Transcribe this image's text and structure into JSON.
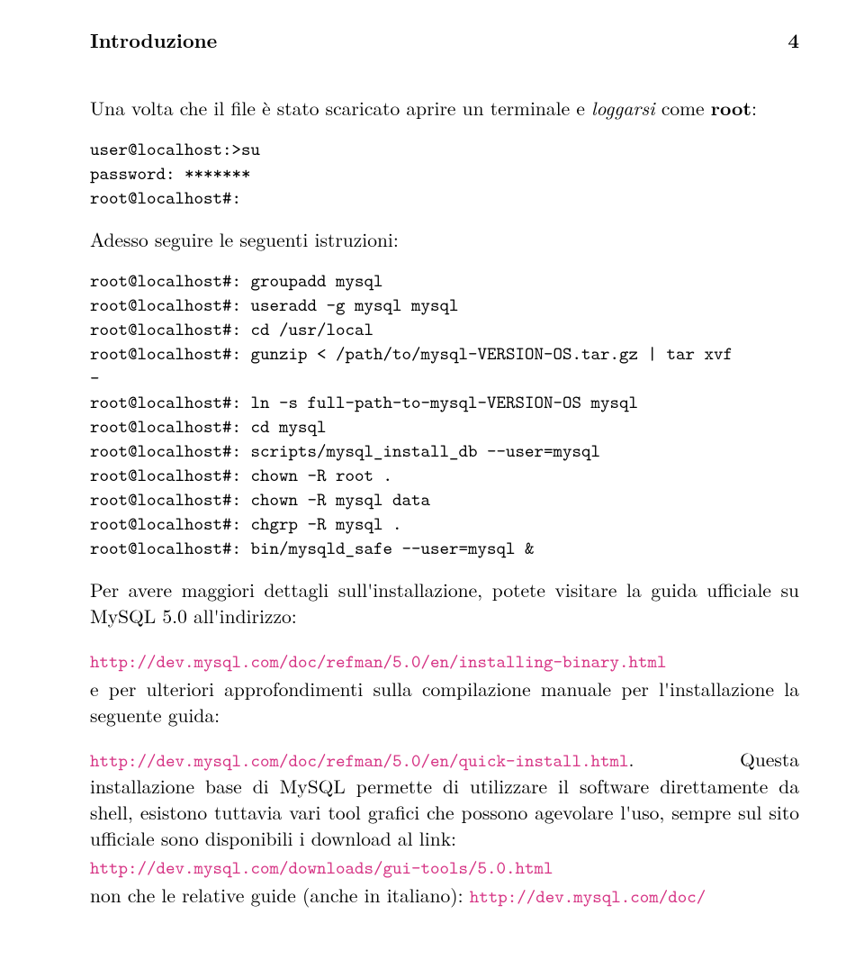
{
  "header": {
    "section": "Introduzione",
    "page_number": "4"
  },
  "p1_pre": "Una volta che il file è stato scaricato aprire un terminale e ",
  "p1_italic": "loggarsi",
  "p1_post": " come ",
  "p1_bold": "root",
  "p1_tail": ":",
  "code1": "user@localhost:>su\npassword: *******\nroot@localhost#:",
  "p2": "Adesso seguire le seguenti istruzioni:",
  "code2": "root@localhost#: groupadd mysql\nroot@localhost#: useradd -g mysql mysql\nroot@localhost#: cd /usr/local\nroot@localhost#: gunzip < /path/to/mysql-VERSION-OS.tar.gz | tar xvf\n-\nroot@localhost#: ln -s full-path-to-mysql-VERSION-OS mysql\nroot@localhost#: cd mysql\nroot@localhost#: scripts/mysql_install_db --user=mysql\nroot@localhost#: chown -R root .\nroot@localhost#: chown -R mysql data\nroot@localhost#: chgrp -R mysql .\nroot@localhost#: bin/mysqld_safe --user=mysql &",
  "p3": "Per avere maggiori dettagli sull'installazione, potete visitare la guida ufficiale su MySQL 5.0 all'indirizzo:",
  "link1": "http://dev.mysql.com/doc/refman/5.0/en/installing-binary.html",
  "p4": "e per ulteriori approfondimenti sulla compilazione manuale per l'installazione la seguente guida:",
  "link2": "http://dev.mysql.com/doc/refman/5.0/en/quick-install.html",
  "p5_after_link2": ". Questa installazione base di MySQL permette di utilizzare il software direttamente da shell, esistono tuttavia vari tool grafici che possono agevolare l'uso, sempre sul sito ufficiale sono disponibili i download al link:",
  "link3": "http://dev.mysql.com/downloads/gui-tools/5.0.html",
  "p6_pre": "non che le relative guide (anche in italiano): ",
  "link4": "http://dev.mysql.com/doc/"
}
